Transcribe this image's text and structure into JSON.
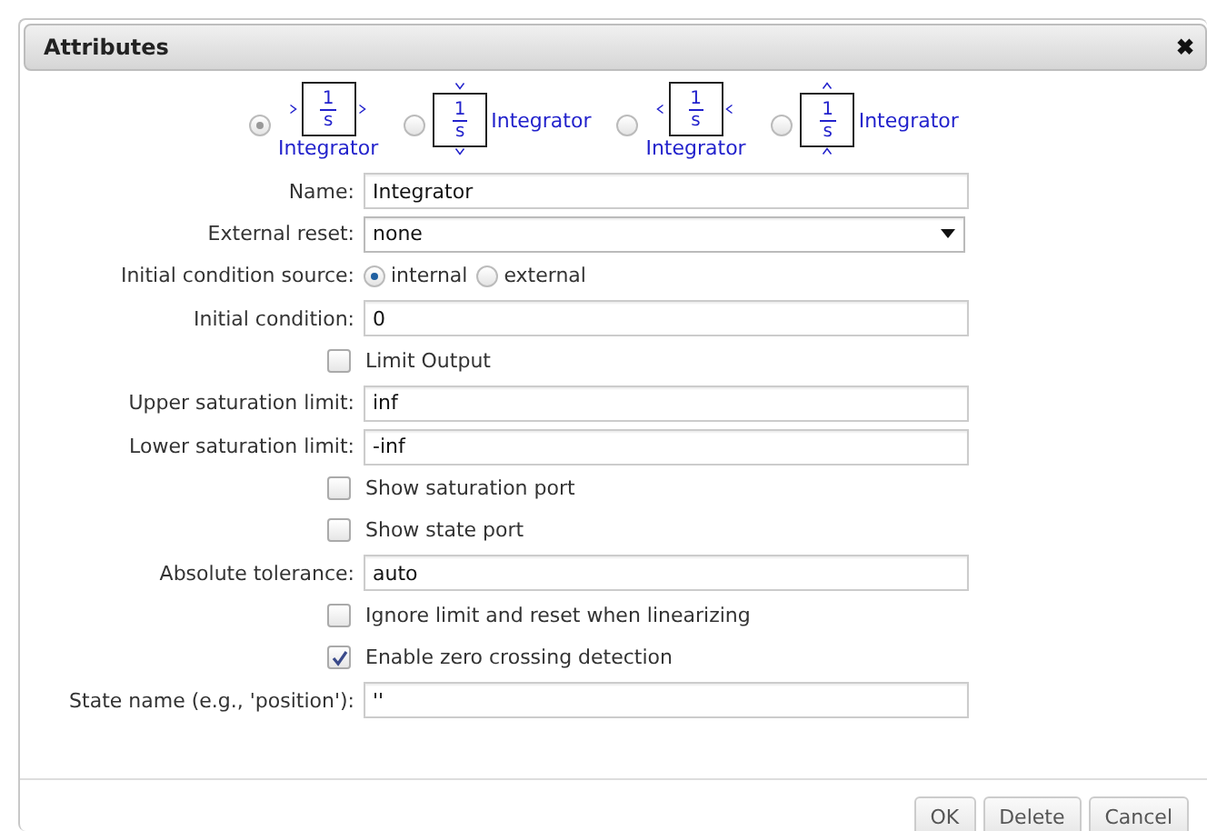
{
  "dialog": {
    "title": "Attributes",
    "close": "✖"
  },
  "orientations": [
    {
      "kind": "right",
      "selected": true,
      "numerator": "1",
      "denominator": "s",
      "label": "Integrator"
    },
    {
      "kind": "down",
      "selected": false,
      "numerator": "1",
      "denominator": "s",
      "label": "Integrator"
    },
    {
      "kind": "left",
      "selected": false,
      "numerator": "1",
      "denominator": "s",
      "label": "Integrator"
    },
    {
      "kind": "up",
      "selected": false,
      "numerator": "1",
      "denominator": "s",
      "label": "Integrator"
    }
  ],
  "fields": [
    {
      "kind": "text",
      "label": "Name:",
      "value": "Integrator"
    },
    {
      "kind": "select",
      "label": "External reset:",
      "value": "none"
    },
    {
      "kind": "radio",
      "label": "Initial condition source:",
      "options": [
        {
          "label": "internal",
          "selected": true
        },
        {
          "label": "external",
          "selected": false
        }
      ]
    },
    {
      "kind": "text",
      "label": "Initial condition:",
      "value": "0"
    },
    {
      "kind": "checkbox",
      "text": "Limit Output",
      "checked": false
    },
    {
      "kind": "text",
      "label": "Upper saturation limit:",
      "value": "inf"
    },
    {
      "kind": "text",
      "label": "Lower saturation limit:",
      "value": "-inf"
    },
    {
      "kind": "checkbox",
      "text": "Show saturation port",
      "checked": false
    },
    {
      "kind": "checkbox",
      "text": "Show state port",
      "checked": false
    },
    {
      "kind": "text",
      "label": "Absolute tolerance:",
      "value": "auto"
    },
    {
      "kind": "checkbox",
      "text": "Ignore limit and reset when linearizing",
      "checked": false
    },
    {
      "kind": "checkbox",
      "text": "Enable zero crossing detection",
      "checked": true
    },
    {
      "kind": "text",
      "label": "State name (e.g., 'position'):",
      "value": "''"
    }
  ],
  "buttons": [
    "OK",
    "Delete",
    "Cancel"
  ]
}
